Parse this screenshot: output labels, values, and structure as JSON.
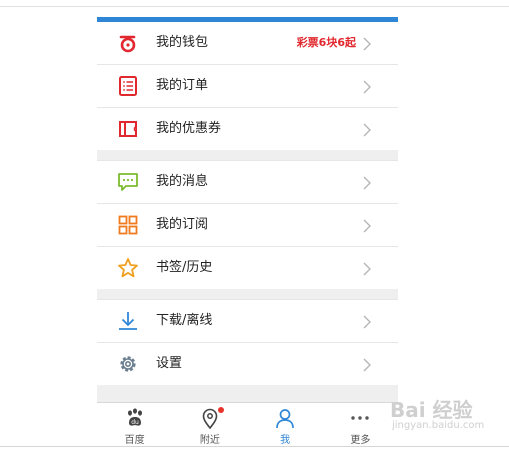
{
  "menu": {
    "section1": [
      {
        "label": "我的钱包",
        "icon": "wallet-icon",
        "badge": "彩票6块6起",
        "color": "#e0282e"
      },
      {
        "label": "我的订单",
        "icon": "order-list-icon",
        "color": "#e0282e"
      },
      {
        "label": "我的优惠券",
        "icon": "coupon-icon",
        "color": "#e0282e"
      }
    ],
    "section2": [
      {
        "label": "我的消息",
        "icon": "message-icon",
        "color": "#7dbb2e"
      },
      {
        "label": "我的订阅",
        "icon": "subscription-grid-icon",
        "color": "#f07a1e"
      },
      {
        "label": "书签/历史",
        "icon": "star-icon",
        "color": "#f0a01e"
      }
    ],
    "section3": [
      {
        "label": "下载/离线",
        "icon": "download-icon",
        "color": "#2f86d6"
      },
      {
        "label": "设置",
        "icon": "gear-icon",
        "color": "#6b7e8f"
      }
    ]
  },
  "tabbar": {
    "tabs": [
      {
        "label": "百度",
        "icon": "baidu-paw-icon"
      },
      {
        "label": "附近",
        "icon": "location-pin-icon",
        "has_dot": true
      },
      {
        "label": "我",
        "icon": "person-icon",
        "active": true
      },
      {
        "label": "更多",
        "icon": "more-dots-icon"
      }
    ]
  },
  "watermark": {
    "main": "Bai 经验",
    "sub": "jingyan.baidu.com"
  },
  "colors": {
    "accent": "#2f86d6",
    "badge": "#e0282e",
    "divider": "#efefef"
  }
}
